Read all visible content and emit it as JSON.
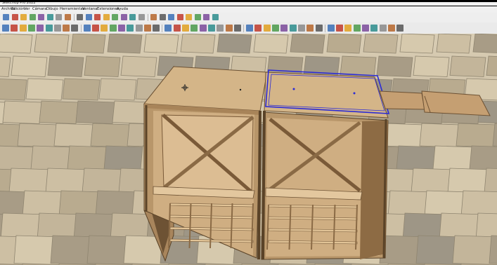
{
  "window": {
    "title": "SketchUp Pro 2022"
  },
  "menu": {
    "items": [
      {
        "label": "Archivo"
      },
      {
        "label": "Edición"
      },
      {
        "label": "Ver"
      },
      {
        "label": "Cámara"
      },
      {
        "label": "Dibujo"
      },
      {
        "label": "Herramientas"
      },
      {
        "label": "Ventana"
      },
      {
        "label": "Extensiones"
      },
      {
        "label": "Ayuda"
      }
    ]
  },
  "toolbar_top": {
    "icons": [
      "select-icon",
      "component-icon",
      "paint-bucket-icon",
      "eraser-icon",
      "line-icon",
      "arc-icon",
      "rectangle-icon",
      "circle-icon",
      "polygon-icon",
      "push-pull-icon",
      "move-icon",
      "rotate-icon",
      "scale-icon",
      "offset-icon",
      "warehouse-icon",
      "extension-warehouse-icon",
      "layout-icon",
      "sections-icon",
      "view-iso-icon",
      "view-top-icon",
      "view-front-icon",
      "view-right-icon",
      "view-back-icon",
      "view-left-icon"
    ]
  },
  "toolbar_main": {
    "icons": [
      "search-icon",
      "select-icon",
      "eraser-icon",
      "pencil-icon",
      "paint-bucket-icon",
      "arc-icon",
      "freehand-icon",
      "shape-icon",
      "move-icon",
      "rotate-icon",
      "scale-icon",
      "push-pull-icon",
      "tape-measure-icon",
      "dimension-icon",
      "protractor-icon",
      "text-icon",
      "axes-icon",
      "3d-text-icon",
      "orbit-icon",
      "pan-icon",
      "zoom-icon",
      "zoom-window-icon",
      "zoom-extents-icon",
      "walk-icon",
      "look-around-icon",
      "position-camera-icon",
      "section-plane-icon",
      "solid-tools-icon",
      "xray-icon",
      "back-edges-icon",
      "wireframe-icon",
      "hidden-line-icon",
      "shaded-icon",
      "textured-icon",
      "monochrome-icon",
      "iso-view-icon",
      "top-view-icon",
      "front-view-icon",
      "right-view-icon",
      "back-view-icon",
      "left-view-icon",
      "styles-icon",
      "shadows-icon",
      "fog-icon",
      "match-photo-icon"
    ]
  },
  "colors": {
    "selection": "#2a2ad6",
    "wood": "#c9a77a",
    "wood_dark": "#8a6a45",
    "floor": "#bfb39c"
  }
}
